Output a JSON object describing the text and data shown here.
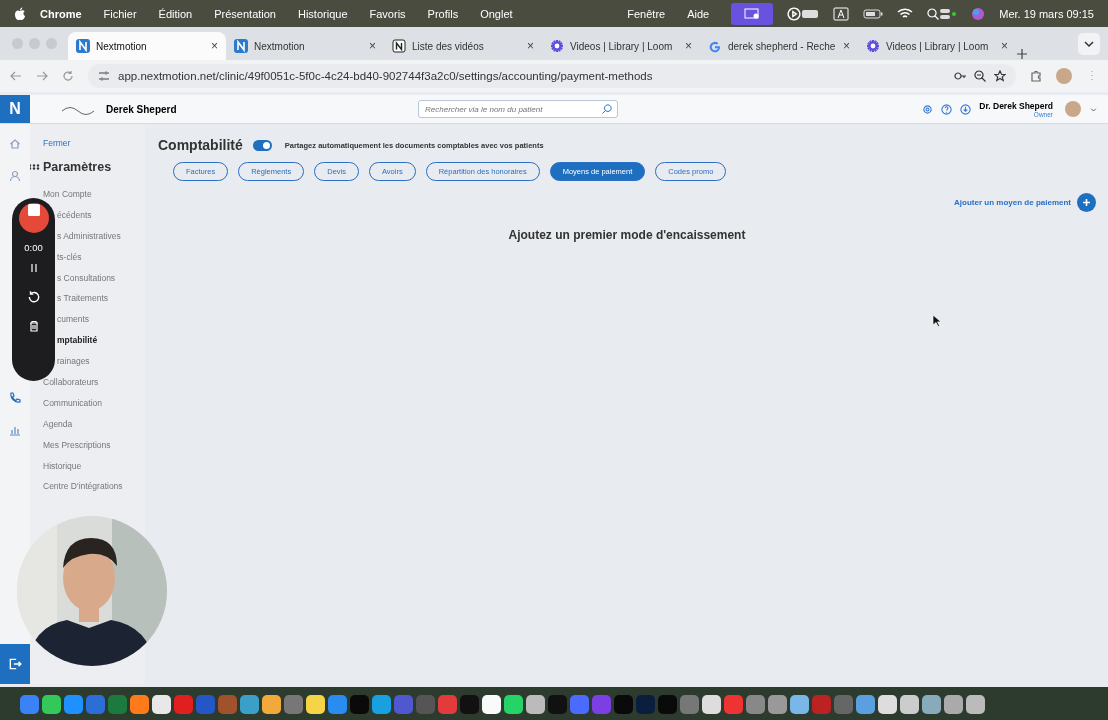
{
  "menu_bar": {
    "app": "Chrome",
    "items": [
      "Fichier",
      "Édition",
      "Présentation",
      "Historique",
      "Favoris",
      "Profils",
      "Onglet"
    ],
    "right_items": [
      "Fenêtre",
      "Aide"
    ],
    "datetime": "Mer. 19 mars  09:15"
  },
  "browser_tabs": [
    {
      "kind": "nextmotion",
      "title": "Nextmotion",
      "close": "×",
      "selected": true
    },
    {
      "kind": "nextmotion",
      "title": "Nextmotion",
      "close": "×",
      "selected": false
    },
    {
      "kind": "notion",
      "title": "Liste des vidéos",
      "close": "×",
      "selected": false
    },
    {
      "kind": "loom",
      "title": "Videos | Library | Loom",
      "close": "×",
      "selected": false
    },
    {
      "kind": "google",
      "title": "derek shepherd - Reche",
      "close": "×",
      "selected": false
    },
    {
      "kind": "loom",
      "title": "Videos | Library | Loom",
      "close": "×",
      "selected": false
    }
  ],
  "address": "app.nextmotion.net/clinic/49f0051c-5f0c-4c24-bd40-902744f3a2c0/settings/accounting/payment-methods",
  "app_header": {
    "logo": "N",
    "clinic": "Derek Sheperd",
    "search_placeholder": "Rechercher via le nom du patient",
    "user_name": "Dr. Derek Sheperd",
    "user_role": "Owner"
  },
  "sidebar": {
    "close": "Fermer",
    "title": "Paramètres",
    "items": [
      {
        "label": "Mon Compte",
        "selected": false
      },
      {
        "label": "écédents",
        "selected": false
      },
      {
        "label": "s Administratives",
        "selected": false
      },
      {
        "label": "ts-clés",
        "selected": false
      },
      {
        "label": "s Consultations",
        "selected": false
      },
      {
        "label": "s Traitements",
        "selected": false
      },
      {
        "label": "cuments",
        "selected": false
      },
      {
        "label": "mptabilité",
        "selected": true
      },
      {
        "label": "rainages",
        "selected": false
      },
      {
        "label": "Collaborateurs",
        "selected": false
      },
      {
        "label": "Communication",
        "selected": false
      },
      {
        "label": "Agenda",
        "selected": false
      },
      {
        "label": "Mes Prescriptions",
        "selected": false
      },
      {
        "label": "Historique",
        "selected": false
      },
      {
        "label": "Centre D'intégrations",
        "selected": false
      }
    ]
  },
  "recorder": {
    "time": "0:00"
  },
  "page": {
    "title": "Comptabilité",
    "share_toggle": {
      "on": true,
      "label": "Partagez automatiquement les documents comptables avec vos patients"
    },
    "tabs": [
      {
        "label": "Factures",
        "selected": false
      },
      {
        "label": "Règlements",
        "selected": false
      },
      {
        "label": "Devis",
        "selected": false
      },
      {
        "label": "Avoirs",
        "selected": false
      },
      {
        "label": "Répartition des honoraires",
        "selected": false
      },
      {
        "label": "Moyens de paiement",
        "selected": true
      },
      {
        "label": "Codes promo",
        "selected": false
      }
    ],
    "add_action": "Ajouter un moyen de paiement",
    "empty_message": "Ajoutez un premier mode d'encaissement"
  }
}
